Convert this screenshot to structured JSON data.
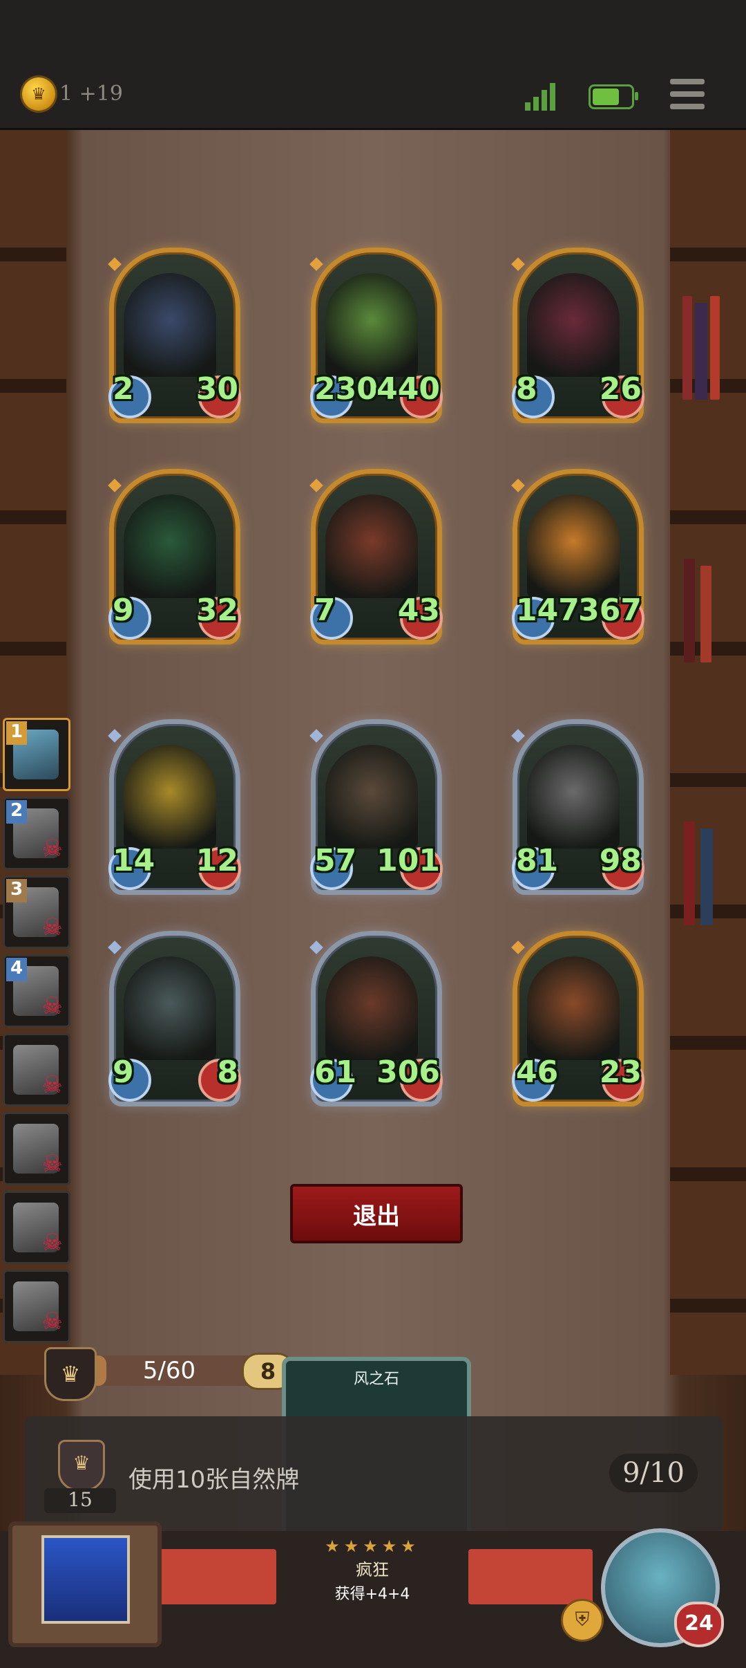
{
  "header": {
    "coin_text": "1 +19",
    "icons": [
      "coin-icon",
      "signal-icon",
      "battery-icon",
      "menu-icon"
    ]
  },
  "board": {
    "cards": [
      {
        "id": "elf-sorceress",
        "attack": "2",
        "health": "30",
        "frame": "gold"
      },
      {
        "id": "leaf-sprout",
        "attack": "230",
        "health": "440",
        "frame": "gold"
      },
      {
        "id": "clown",
        "attack": "8",
        "health": "26",
        "frame": "gold"
      },
      {
        "id": "vine-skull",
        "attack": "9",
        "health": "32",
        "frame": "gold"
      },
      {
        "id": "tomato-imp",
        "attack": "7",
        "health": "43",
        "frame": "gold"
      },
      {
        "id": "pumpkin-ghost",
        "attack": "147",
        "health": "367",
        "frame": "gold"
      },
      {
        "id": "fire-dwarf",
        "attack": "14",
        "health": "12",
        "frame": "silver"
      },
      {
        "id": "bald-brute",
        "attack": "57",
        "health": "101",
        "frame": "silver"
      },
      {
        "id": "armored-knight",
        "attack": "81",
        "health": "98",
        "frame": "silver"
      },
      {
        "id": "fish-ogre",
        "attack": "9",
        "health": "8",
        "frame": "silver"
      },
      {
        "id": "hooded-rogue",
        "attack": "61",
        "health": "306",
        "frame": "silver"
      },
      {
        "id": "red-dwarf",
        "attack": "46",
        "health": "23",
        "frame": "gold"
      }
    ]
  },
  "side_list": {
    "slots": [
      {
        "num": "1",
        "dead": false,
        "active": true
      },
      {
        "num": "2",
        "dead": true
      },
      {
        "num": "3",
        "dead": true
      },
      {
        "num": "4",
        "dead": true
      },
      {
        "num": "",
        "dead": true
      },
      {
        "num": "",
        "dead": true
      },
      {
        "num": "",
        "dead": true
      },
      {
        "num": "",
        "dead": true
      }
    ]
  },
  "exit_button": {
    "label": "退出"
  },
  "progress": {
    "text": "5/60",
    "badge": "8",
    "fraction": 0.083
  },
  "card_preview": {
    "title": "风之石"
  },
  "mission": {
    "level": "15",
    "text": "使用10张自然牌",
    "count": "9/10"
  },
  "crazy": {
    "stars": "★★★★★",
    "name": "疯狂",
    "effect": "获得+4+4"
  },
  "player": {
    "hp": "24"
  }
}
